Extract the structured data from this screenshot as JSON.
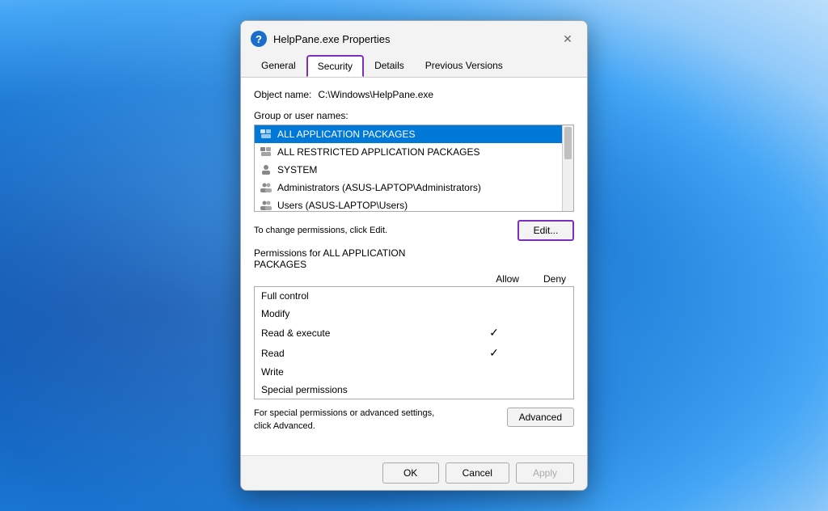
{
  "background": {
    "color1": "#0d47a1",
    "color2": "#42a5f5"
  },
  "dialog": {
    "title": "HelpPane.exe Properties",
    "close_label": "✕",
    "icon_label": "?"
  },
  "tabs": [
    {
      "id": "general",
      "label": "General",
      "active": false
    },
    {
      "id": "security",
      "label": "Security",
      "active": true
    },
    {
      "id": "details",
      "label": "Details",
      "active": false
    },
    {
      "id": "previous_versions",
      "label": "Previous Versions",
      "active": false
    }
  ],
  "body": {
    "object_label": "Object name:",
    "object_value": "C:\\Windows\\HelpPane.exe",
    "group_label": "Group or user names:",
    "users": [
      {
        "id": "all_app",
        "name": "ALL APPLICATION PACKAGES",
        "selected": true
      },
      {
        "id": "all_restricted",
        "name": "ALL RESTRICTED APPLICATION PACKAGES",
        "selected": false
      },
      {
        "id": "system",
        "name": "SYSTEM",
        "selected": false
      },
      {
        "id": "administrators",
        "name": "Administrators (ASUS-LAPTOP\\Administrators)",
        "selected": false
      },
      {
        "id": "users",
        "name": "Users (ASUS-LAPTOP\\Users)",
        "selected": false
      }
    ],
    "edit_hint": "To change permissions, click Edit.",
    "edit_label": "Edit...",
    "permissions_header": "Permissions for ALL APPLICATION\nPACKAGES",
    "allow_col": "Allow",
    "deny_col": "Deny",
    "permissions": [
      {
        "name": "Full control",
        "allow": false,
        "deny": false
      },
      {
        "name": "Modify",
        "allow": false,
        "deny": false
      },
      {
        "name": "Read & execute",
        "allow": true,
        "deny": false
      },
      {
        "name": "Read",
        "allow": true,
        "deny": false
      },
      {
        "name": "Write",
        "allow": false,
        "deny": false
      },
      {
        "name": "Special permissions",
        "allow": false,
        "deny": false
      }
    ],
    "advanced_hint": "For special permissions or advanced settings, click Advanced.",
    "advanced_label": "Advanced"
  },
  "footer": {
    "ok_label": "OK",
    "cancel_label": "Cancel",
    "apply_label": "Apply"
  }
}
